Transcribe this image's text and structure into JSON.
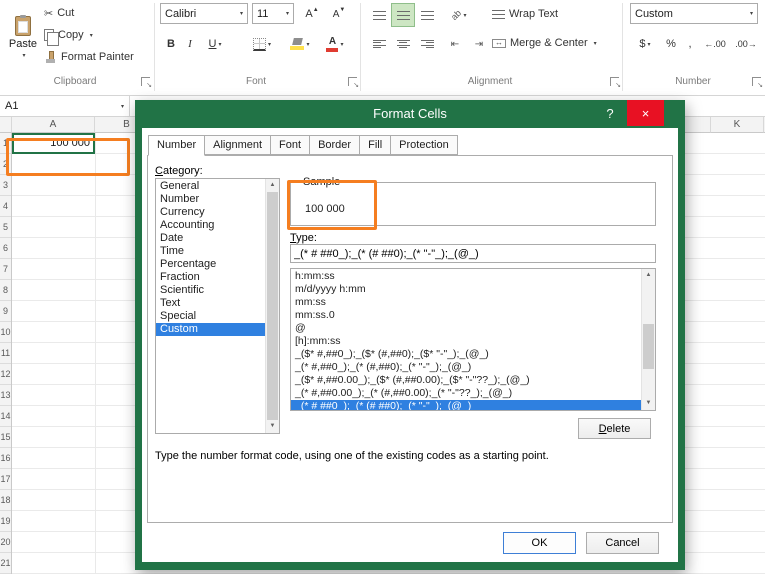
{
  "ribbon": {
    "clipboard": {
      "label": "Clipboard",
      "paste": "Paste",
      "cut": "Cut",
      "copy": "Copy",
      "format_painter": "Format Painter"
    },
    "font": {
      "label": "Font",
      "family": "Calibri",
      "size": "11",
      "bold": "B",
      "italic": "I",
      "underline": "U",
      "grow_font": "A",
      "shrink_font": "A"
    },
    "alignment": {
      "label": "Alignment",
      "wrap_text": "Wrap Text",
      "merge_center": "Merge & Center",
      "orientation": "ab"
    },
    "number": {
      "label": "Number",
      "format": "Custom",
      "currency": "$",
      "percent": "%",
      "comma": ",",
      "increase_decimal": "←.00",
      "decrease_decimal": ".00→"
    }
  },
  "formula_bar": {
    "name_box": "A1"
  },
  "grid": {
    "columns": [
      "A",
      "B",
      "K"
    ],
    "row_numbers": [
      "1",
      "2",
      "3",
      "4",
      "5",
      "6",
      "7",
      "8",
      "9",
      "10",
      "11",
      "12",
      "13",
      "14",
      "15",
      "16",
      "17",
      "18",
      "19",
      "20",
      "21"
    ],
    "cell_a1": "100 000"
  },
  "dialog": {
    "title": "Format Cells",
    "help_glyph": "?",
    "close_glyph": "×",
    "tabs": [
      "Number",
      "Alignment",
      "Font",
      "Border",
      "Fill",
      "Protection"
    ],
    "active_tab": "Number",
    "category_label": "Category:",
    "categories": [
      "General",
      "Number",
      "Currency",
      "Accounting",
      "Date",
      "Time",
      "Percentage",
      "Fraction",
      "Scientific",
      "Text",
      "Special",
      "Custom"
    ],
    "selected_category": "Custom",
    "sample_label": "Sample",
    "sample_value": "100 000",
    "type_label": "Type:",
    "type_value": "_(* # ##0_);_(* (# ##0);_(* \"-\"_);_(@_)",
    "format_codes": [
      "h:mm:ss",
      "m/d/yyyy h:mm",
      "mm:ss",
      "mm:ss.0",
      "@",
      "[h]:mm:ss",
      "_($* #,##0_);_($* (#,##0);_($* \"-\"_);_(@_)",
      "_(* #,##0_);_(* (#,##0);_(* \"-\"_);_(@_)",
      "_($* #,##0.00_);_($* (#,##0.00);_($* \"-\"??_);_(@_)",
      "_(* #,##0.00_);_(* (#,##0.00);_(* \"-\"??_);_(@_)",
      "_(* # ##0_);_(* (# ##0);_(* \"-\"_);_(@_)"
    ],
    "selected_code_index": 10,
    "delete_label": "Delete",
    "hint": "Type the number format code, using one of the existing codes as a starting point.",
    "ok_label": "OK",
    "cancel_label": "Cancel"
  },
  "colors": {
    "excel_green": "#217346",
    "highlight_orange": "#F57E20",
    "selection_blue": "#2F80E0",
    "close_red": "#E81123",
    "active_toggle_green": "#CDE6C3"
  }
}
